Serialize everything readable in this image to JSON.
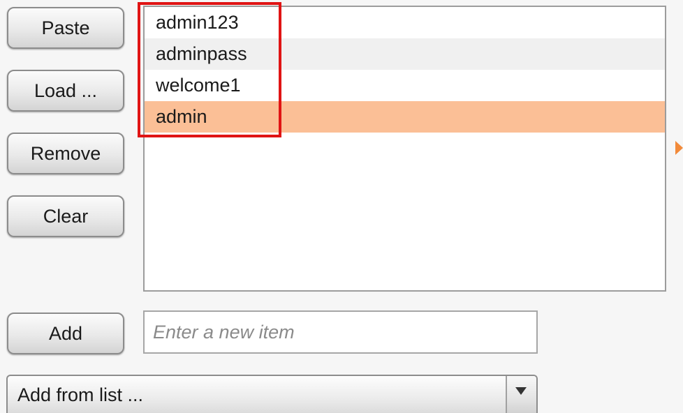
{
  "buttons": {
    "paste": "Paste",
    "load": "Load ...",
    "remove": "Remove",
    "clear": "Clear",
    "add": "Add"
  },
  "list": {
    "items": [
      "admin123",
      "adminpass",
      "welcome1",
      "admin"
    ],
    "selected_item": "admin"
  },
  "new_item_input": {
    "value": "",
    "placeholder": "Enter a new item"
  },
  "add_from_list": {
    "selected_label": "Add from list ..."
  },
  "colors": {
    "selected_row": "#fbbf96",
    "annotation_box": "#e01414",
    "side_arrow": "#f28a3a"
  }
}
